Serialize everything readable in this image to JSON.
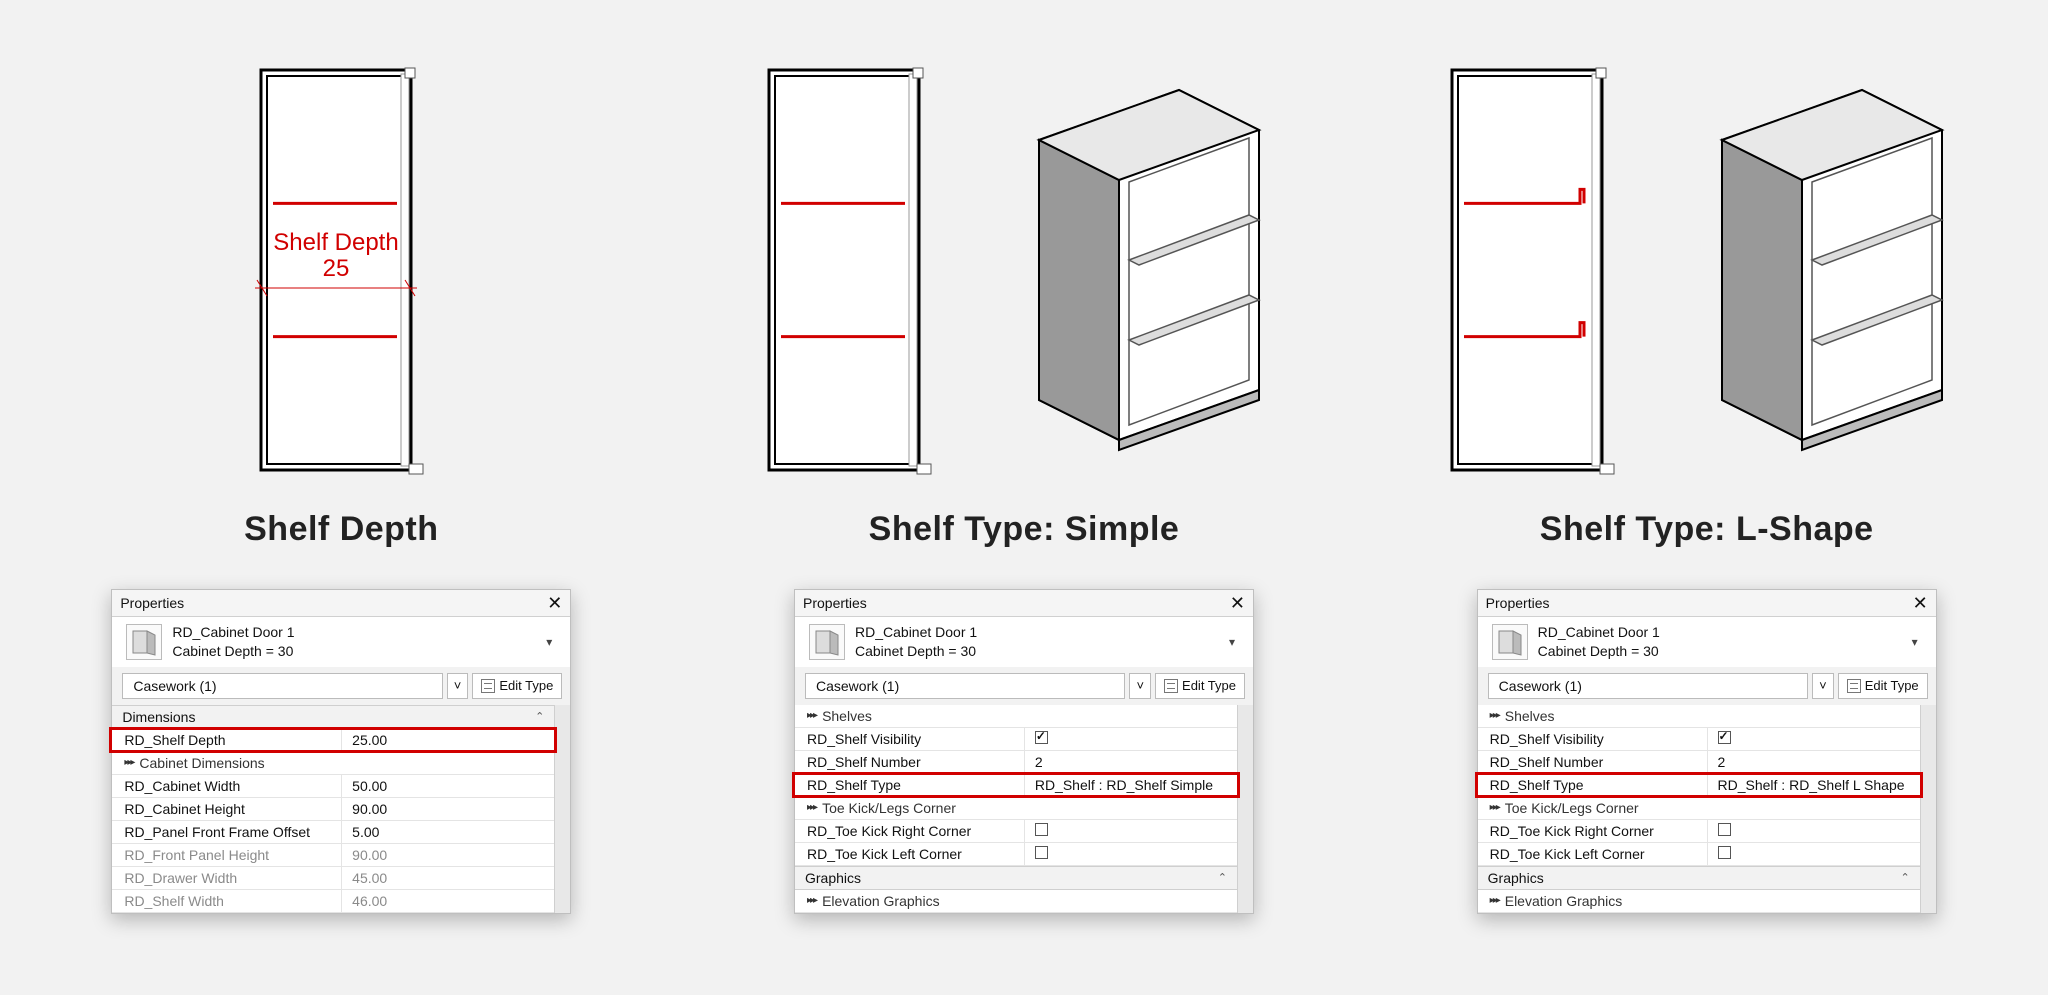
{
  "columns": [
    {
      "caption": "Shelf Depth",
      "annotation": {
        "label": "Shelf Depth",
        "value": "25"
      },
      "drawing": "front_dim",
      "panel": {
        "title": "Properties",
        "type_name": "RD_Cabinet Door 1",
        "type_sub": "Cabinet Depth = 30",
        "selector": "Casework (1)",
        "edit_type": "Edit Type",
        "groups": [
          {
            "kind": "group",
            "label": "Dimensions"
          },
          {
            "kind": "prop",
            "name": "RD_Shelf Depth",
            "value": "25.00",
            "highlight": true
          },
          {
            "kind": "sub",
            "label": "Cabinet Dimensions"
          },
          {
            "kind": "prop",
            "name": "RD_Cabinet Width",
            "value": "50.00"
          },
          {
            "kind": "prop",
            "name": "RD_Cabinet Height",
            "value": "90.00"
          },
          {
            "kind": "prop",
            "name": "RD_Panel Front Frame Offset",
            "value": "5.00"
          },
          {
            "kind": "prop",
            "name": "RD_Front Panel Height",
            "value": "90.00",
            "dim": true
          },
          {
            "kind": "prop",
            "name": "RD_Drawer Width",
            "value": "45.00",
            "dim": true
          },
          {
            "kind": "prop",
            "name": "RD_Shelf Width",
            "value": "46.00",
            "dim": true
          }
        ]
      }
    },
    {
      "caption": "Shelf Type: Simple",
      "drawing": "front_iso_simple",
      "panel": {
        "title": "Properties",
        "type_name": "RD_Cabinet Door 1",
        "type_sub": "Cabinet Depth = 30",
        "selector": "Casework (1)",
        "edit_type": "Edit Type",
        "groups": [
          {
            "kind": "sub",
            "label": "Shelves"
          },
          {
            "kind": "prop",
            "name": "RD_Shelf Visibility",
            "value": "",
            "check": true
          },
          {
            "kind": "prop",
            "name": "RD_Shelf Number",
            "value": "2"
          },
          {
            "kind": "prop",
            "name": "RD_Shelf Type<Casework>",
            "value": "RD_Shelf : RD_Shelf Simple",
            "highlight": true
          },
          {
            "kind": "sub",
            "label": "Toe Kick/Legs Corner"
          },
          {
            "kind": "prop",
            "name": "RD_Toe Kick Right Corner",
            "value": "",
            "check": false
          },
          {
            "kind": "prop",
            "name": "RD_Toe Kick Left Corner",
            "value": "",
            "check": false
          },
          {
            "kind": "group",
            "label": "Graphics"
          },
          {
            "kind": "sub",
            "label": "Elevation Graphics"
          }
        ]
      }
    },
    {
      "caption": "Shelf Type: L-Shape",
      "drawing": "front_iso_lshape",
      "panel": {
        "title": "Properties",
        "type_name": "RD_Cabinet Door 1",
        "type_sub": "Cabinet Depth = 30",
        "selector": "Casework (1)",
        "edit_type": "Edit Type",
        "groups": [
          {
            "kind": "sub",
            "label": "Shelves"
          },
          {
            "kind": "prop",
            "name": "RD_Shelf Visibility",
            "value": "",
            "check": true
          },
          {
            "kind": "prop",
            "name": "RD_Shelf Number",
            "value": "2"
          },
          {
            "kind": "prop",
            "name": "RD_Shelf Type<Casework>",
            "value": "RD_Shelf : RD_Shelf L Shape",
            "highlight": true
          },
          {
            "kind": "sub",
            "label": "Toe Kick/Legs Corner"
          },
          {
            "kind": "prop",
            "name": "RD_Toe Kick Right Corner",
            "value": "",
            "check": false
          },
          {
            "kind": "prop",
            "name": "RD_Toe Kick Left Corner",
            "value": "",
            "check": false
          },
          {
            "kind": "group",
            "label": "Graphics"
          },
          {
            "kind": "sub",
            "label": "Elevation Graphics"
          }
        ]
      }
    }
  ]
}
